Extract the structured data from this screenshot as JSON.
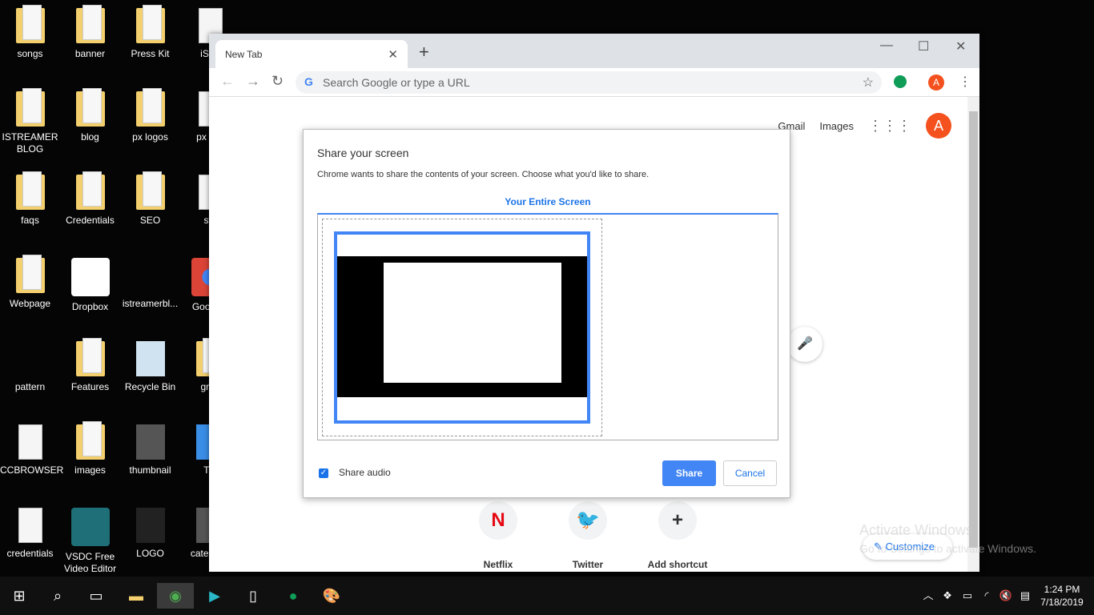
{
  "desktop": {
    "icons": [
      {
        "label": "songs",
        "kind": "folder"
      },
      {
        "label": "banner",
        "kind": "folder"
      },
      {
        "label": "Press Kit",
        "kind": "folder"
      },
      {
        "label": "iStre",
        "kind": "doc"
      },
      {
        "label": "ISTREAMER BLOG",
        "kind": "folder"
      },
      {
        "label": "blog",
        "kind": "folder"
      },
      {
        "label": "px logos",
        "kind": "folder"
      },
      {
        "label": "px key",
        "kind": "doc"
      },
      {
        "label": "faqs",
        "kind": "folder"
      },
      {
        "label": "Credentials",
        "kind": "folder"
      },
      {
        "label": "SEO",
        "kind": "folder"
      },
      {
        "label": "sta",
        "kind": "doc"
      },
      {
        "label": "Webpage",
        "kind": "folder"
      },
      {
        "label": "Dropbox",
        "kind": "dropbox"
      },
      {
        "label": "istreamerbl...",
        "kind": "none"
      },
      {
        "label": "Goo Chr",
        "kind": "chrome"
      },
      {
        "label": "pattern",
        "kind": "none"
      },
      {
        "label": "Features",
        "kind": "folder"
      },
      {
        "label": "Recycle Bin",
        "kind": "bin"
      },
      {
        "label": "grap",
        "kind": "folder"
      },
      {
        "label": "CCBROWSER",
        "kind": "doc"
      },
      {
        "label": "images",
        "kind": "folder"
      },
      {
        "label": "thumbnail",
        "kind": "image"
      },
      {
        "label": "Thi",
        "kind": "pc"
      },
      {
        "label": "credentials",
        "kind": "doc"
      },
      {
        "label": "VSDC Free Video Editor",
        "kind": "vsdc"
      },
      {
        "label": "LOGO",
        "kind": "logo"
      },
      {
        "label": "cate rank",
        "kind": "image"
      }
    ]
  },
  "browser": {
    "tab_title": "New Tab",
    "omnibox_placeholder": "Search Google or type a URL",
    "profile_initial": "A",
    "links": {
      "gmail": "Gmail",
      "images": "Images"
    },
    "shortcuts": [
      {
        "label": "Netflix",
        "glyph": "N",
        "color": "#e50914"
      },
      {
        "label": "Twitter",
        "glyph": "🐦",
        "color": "#1da1f2"
      },
      {
        "label": "Add shortcut",
        "glyph": "+",
        "color": "#333"
      }
    ],
    "customize": "Customize"
  },
  "dialog": {
    "title": "Share your screen",
    "description": "Chrome wants to share the contents of your screen. Choose what you'd like to share.",
    "tab": "Your Entire Screen",
    "share_audio": "Share audio",
    "share_audio_checked": true,
    "share": "Share",
    "cancel": "Cancel"
  },
  "watermark": {
    "title": "Activate Windows",
    "subtitle": "Go to Settings to activate Windows."
  },
  "taskbar": {
    "time": "1:24 PM",
    "date": "7/18/2019"
  },
  "colors": {
    "accent": "#4285f4",
    "profile": "#f4511e"
  }
}
